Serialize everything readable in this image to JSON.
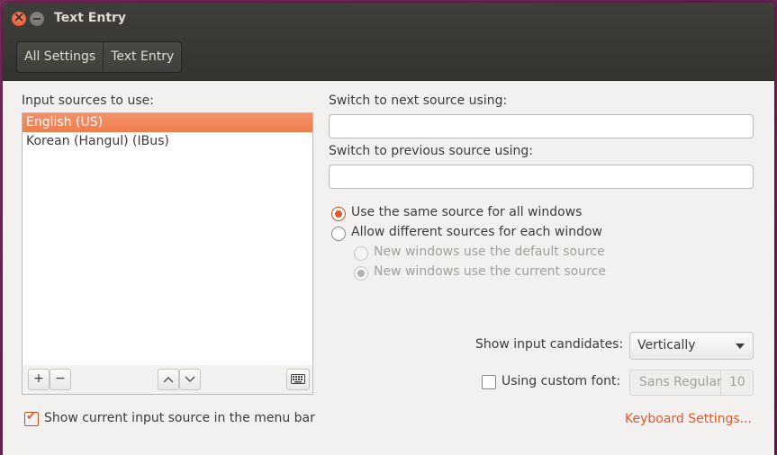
{
  "window": {
    "title": "Text Entry"
  },
  "breadcrumb": {
    "all_settings": "All Settings",
    "text_entry": "Text Entry"
  },
  "input_sources": {
    "label": "Input sources to use:",
    "items": [
      "English (US)",
      "Korean (Hangul) (IBus)"
    ],
    "selected_index": 0,
    "add_symbol": "+",
    "remove_symbol": "−",
    "up_symbol": "⌃",
    "down_symbol": "⌄"
  },
  "switch_next": {
    "label": "Switch to next source using:",
    "value": ""
  },
  "switch_prev": {
    "label": "Switch to previous source using:",
    "value": ""
  },
  "source_mode": {
    "same_label": "Use the same source for all windows",
    "different_label": "Allow different sources for each window",
    "default_label": "New windows use the default source",
    "current_label": "New windows use the current source",
    "selected": "same"
  },
  "candidates": {
    "label": "Show input candidates:",
    "value": "Vertically"
  },
  "custom_font": {
    "label": "Using custom font:",
    "checked": false,
    "font_name": "Sans Regular",
    "font_size": "10"
  },
  "show_in_menu_bar": {
    "label": "Show current input source in the menu bar",
    "checked": true
  },
  "keyboard_settings_link": "Keyboard Settings...",
  "colors": {
    "accent": "#e2592a",
    "selection": "#f07746",
    "titlebar": "#3c3b37",
    "background": "#f2f1f0"
  }
}
